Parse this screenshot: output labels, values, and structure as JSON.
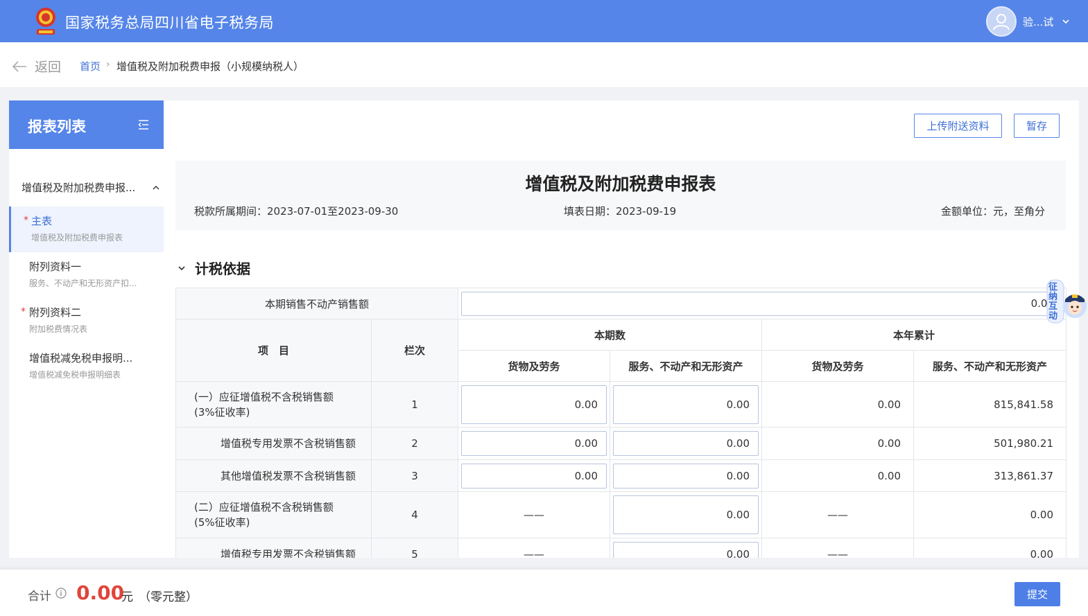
{
  "header": {
    "site_title": "国家税务总局四川省电子税务局",
    "user_name": "验...试",
    "brand_color": "#5585e8"
  },
  "subbar": {
    "back_label": "返回",
    "breadcrumb_home": "首页",
    "breadcrumb_sep": "›",
    "breadcrumb_current": "增值税及附加税费申报（小规模纳税人）"
  },
  "sidebar": {
    "title": "报表列表",
    "group_label": "增值税及附加税费申报...",
    "items": [
      {
        "title": "主表",
        "subtitle": "增值税及附加税费申报表",
        "required": "*"
      },
      {
        "title": "附列资料一",
        "subtitle": "服务、不动产和无形资产扣...",
        "required": ""
      },
      {
        "title": "附列资料二",
        "subtitle": "附加税费情况表",
        "required": "*"
      },
      {
        "title": "增值税减免税申报明...",
        "subtitle": "增值税减免税申报明细表",
        "required": ""
      }
    ]
  },
  "toolbar": {
    "upload_label": "上传附送资料",
    "save_label": "暂存"
  },
  "form": {
    "title": "增值税及附加税费申报表",
    "period": "税款所属期间：2023-07-01至2023-09-30",
    "fill_date": "填表日期：2023-09-19",
    "unit": "金额单位：元，至角分"
  },
  "section": {
    "title": "计税依据"
  },
  "table": {
    "property_label": "本期销售不动产销售额",
    "property_value": "0.00",
    "col_item": "项　目",
    "col_no": "栏次",
    "col_current": "本期数",
    "col_ytd": "本年累计",
    "col_goods": "货物及劳务",
    "col_services": "服务、不动产和无形资产",
    "dash": "——",
    "rows": [
      {
        "item": "(一）应征增值税不含税销售额\n(3%征收率)",
        "no": "1",
        "cur_goods": "0.00",
        "cur_services": "0.00",
        "ytd_goods": "0.00",
        "ytd_services": "815,841.58"
      },
      {
        "item": "增值税专用发票不含税销售额",
        "no": "2",
        "cur_goods": "0.00",
        "cur_services": "0.00",
        "ytd_goods": "0.00",
        "ytd_services": "501,980.21"
      },
      {
        "item": "其他增值税发票不含税销售额",
        "no": "3",
        "cur_goods": "0.00",
        "cur_services": "0.00",
        "ytd_goods": "0.00",
        "ytd_services": "313,861.37"
      },
      {
        "item": "(二）应征增值税不含税销售额\n(5%征收率)",
        "no": "4",
        "cur_goods": "——",
        "cur_services": "0.00",
        "ytd_goods": "——",
        "ytd_services": "0.00"
      },
      {
        "item": "增值税专用发票不含税销售额",
        "no": "5",
        "cur_goods": "——",
        "cur_services": "0.00",
        "ytd_goods": "——",
        "ytd_services": "0.00"
      }
    ]
  },
  "float_helper": {
    "label": "征纳互动"
  },
  "footer": {
    "total_label": "合计",
    "total_amount": "0.00",
    "total_unit": "元",
    "total_words": "（零元整）",
    "submit_label": "提交"
  }
}
